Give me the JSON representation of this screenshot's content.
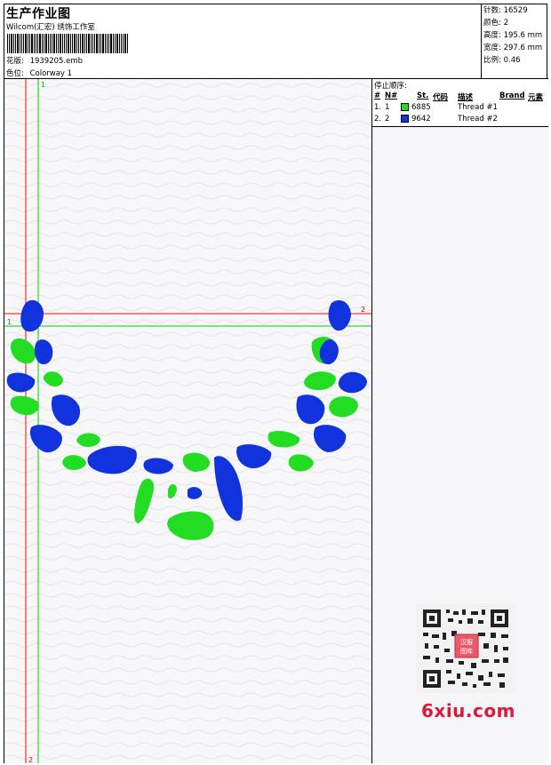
{
  "header": {
    "title": "生产作业图",
    "company": "Wilcom(汇宏) 绣饰工作室",
    "design_label": "花版:",
    "design_value": "1939205.emb",
    "colorway_label": "色位:",
    "colorway_value": "Colorway 1"
  },
  "stats": [
    {
      "label": "针数:",
      "value": "16529"
    },
    {
      "label": "颜色:",
      "value": "2"
    },
    {
      "label": "高度:",
      "value": "195.6 mm"
    },
    {
      "label": "宽度:",
      "value": "297.6 mm"
    },
    {
      "label": "比例:",
      "value": "0.46"
    }
  ],
  "stop_sequence": {
    "title": "停止顺序:",
    "columns": [
      "#",
      "N#",
      "St.",
      "代码",
      "描述",
      "Brand",
      "元素"
    ],
    "rows": [
      {
        "num": "1.",
        "n": "1",
        "color": "#22dd22",
        "code": "6885",
        "desc": "Thread #1"
      },
      {
        "num": "2.",
        "n": "2",
        "color": "#1133dd",
        "code": "9642",
        "desc": "Thread #2"
      }
    ]
  },
  "guides": {
    "vertical_label_top": "1",
    "vertical_label_bottom": "2",
    "horizontal_label_left": "1",
    "horizontal_label_right": "2"
  },
  "colors": {
    "green": "#22dd22",
    "blue": "#1133dd",
    "guide_red": "#ff0000",
    "guide_green": "#00cc00",
    "watermark": "#d91a3a"
  },
  "watermark": {
    "text": "6xiu.com",
    "stamp_text": "汉服图库"
  }
}
